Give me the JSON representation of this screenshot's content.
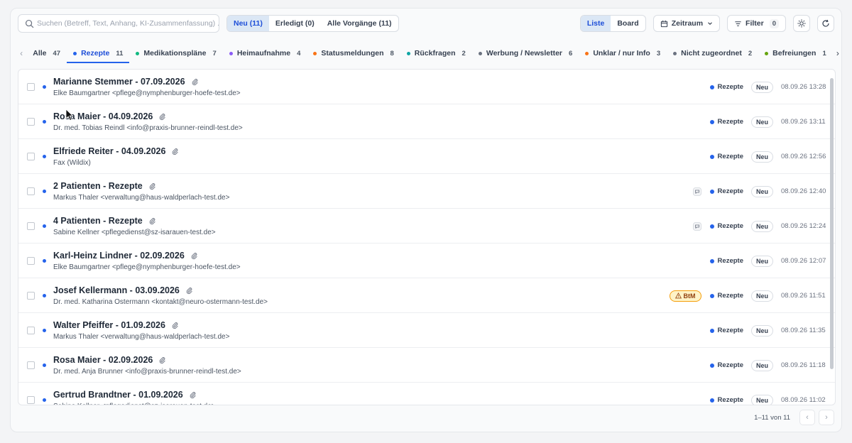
{
  "toolbar": {
    "search_placeholder": "Suchen (Betreff, Text, Anhang, KI-Zusammenfassung) ...",
    "status_filters": [
      {
        "label": "Neu (11)"
      },
      {
        "label": "Erledigt (0)"
      },
      {
        "label": "Alle Vorgänge (11)"
      }
    ],
    "view_modes": [
      {
        "label": "Liste"
      },
      {
        "label": "Board"
      }
    ],
    "zeitraum_label": "Zeitraum",
    "filter_label": "Filter",
    "filter_count": "0"
  },
  "tabs": [
    {
      "label": "Alle",
      "count": "47",
      "color": ""
    },
    {
      "label": "Rezepte",
      "count": "11",
      "color": "#2563eb"
    },
    {
      "label": "Medikationspläne",
      "count": "7",
      "color": "#10b981"
    },
    {
      "label": "Heimaufnahme",
      "count": "4",
      "color": "#8b5cf6"
    },
    {
      "label": "Statusmeldungen",
      "count": "8",
      "color": "#f97316"
    },
    {
      "label": "Rückfragen",
      "count": "2",
      "color": "#0ea5a4"
    },
    {
      "label": "Werbung / Newsletter",
      "count": "6",
      "color": "#6b7280"
    },
    {
      "label": "Unklar / nur Info",
      "count": "3",
      "color": "#f97316"
    },
    {
      "label": "Nicht zugeordnet",
      "count": "2",
      "color": "#6b7280"
    },
    {
      "label": "Befreiungen",
      "count": "1",
      "color": "#65a30d"
    }
  ],
  "active_tab": "Rezepte",
  "rows": [
    {
      "subject": "Marianne Stemmer - 07.09.2026",
      "sender": "Elke Baumgartner <pflege@nymphenburger-hoefe-test.de>",
      "category": "Rezepte",
      "status": "Neu",
      "date": "08.09.26 13:28"
    },
    {
      "subject": "Rosa Maier - 04.09.2026",
      "sender": "Dr. med. Tobias Reindl <info@praxis-brunner-reindl-test.de>",
      "category": "Rezepte",
      "status": "Neu",
      "date": "08.09.26 13:11"
    },
    {
      "subject": "Elfriede Reiter - 04.09.2026",
      "sender": "Fax (Wildix)",
      "category": "Rezepte",
      "status": "Neu",
      "date": "08.09.26 12:56"
    },
    {
      "subject": "2 Patienten - Rezepte",
      "sender": "Markus Thaler <verwaltung@haus-waldperlach-test.de>",
      "category": "Rezepte",
      "status": "Neu",
      "date": "08.09.26 12:40",
      "extra": "chat"
    },
    {
      "subject": "4 Patienten - Rezepte",
      "sender": "Sabine Kellner <pflegedienst@sz-isarauen-test.de>",
      "category": "Rezepte",
      "status": "Neu",
      "date": "08.09.26 12:24",
      "extra": "chat"
    },
    {
      "subject": "Karl-Heinz Lindner - 02.09.2026",
      "sender": "Elke Baumgartner <pflege@nymphenburger-hoefe-test.de>",
      "category": "Rezepte",
      "status": "Neu",
      "date": "08.09.26 12:07"
    },
    {
      "subject": "Josef Kellermann - 03.09.2026",
      "sender": "Dr. med. Katharina Ostermann <kontakt@neuro-ostermann-test.de>",
      "category": "Rezepte",
      "status": "Neu",
      "date": "08.09.26 11:51",
      "extra": "btm",
      "extra_label": "BtM"
    },
    {
      "subject": "Walter Pfeiffer - 01.09.2026",
      "sender": "Markus Thaler <verwaltung@haus-waldperlach-test.de>",
      "category": "Rezepte",
      "status": "Neu",
      "date": "08.09.26 11:35"
    },
    {
      "subject": "Rosa Maier - 02.09.2026",
      "sender": "Dr. med. Anja Brunner <info@praxis-brunner-reindl-test.de>",
      "category": "Rezepte",
      "status": "Neu",
      "date": "08.09.26 11:18"
    },
    {
      "subject": "Gertrud Brandtner - 01.09.2026",
      "sender": "Sabine Kellner <pflegedienst@sz-isarauen-test.de>",
      "category": "Rezepte",
      "status": "Neu",
      "date": "08.09.26 11:02"
    }
  ],
  "pagination": {
    "range": "1–11 von 11"
  },
  "colors": {
    "accent": "#2563eb",
    "btm_bg": "#fef3c7",
    "btm_border": "#f59e0b"
  }
}
